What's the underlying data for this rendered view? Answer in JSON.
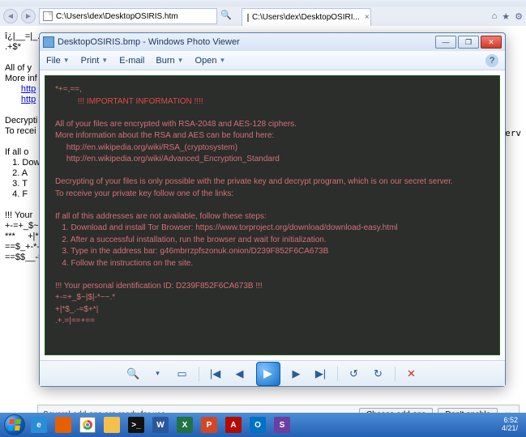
{
  "ie": {
    "address": "C:\\Users\\dex\\DesktopOSIRIS.htm",
    "search_glyph": "🔍",
    "tab_title": "C:\\Users\\dex\\DesktopOSIRI...",
    "winbtns": {
      "home": "⌂",
      "star": "★",
      "gear": "⚙"
    },
    "htm_pre1": "î¿|__=|_.\n.+$*\n\nAll of y\nMore inf",
    "htm_link1": "http",
    "htm_link2": "http",
    "htm_pre2": "\nDecrypti\nTo recei\n\nIf all o\n   1. Dow\n   2. A\n   3. T\n   4. F\n\n!!! Your\n+-=+_$~|\n***     +|*$_.-=\n==$_+-*-\n==$$__-=",
    "htm_right": "serv"
  },
  "pv": {
    "title": "DesktopOSIRIS.bmp - Windows Photo Viewer",
    "menu": {
      "file": "File",
      "print": "Print",
      "email": "E-mail",
      "burn": "Burn",
      "open": "Open"
    },
    "help": "?",
    "winbtns": {
      "min": "—",
      "max": "❐",
      "close": "✕"
    },
    "ctrl": {
      "zoomout": "🔍",
      "zoomdd": "▾",
      "fit": "▭",
      "first": "|◀",
      "prev": "◀",
      "slide": "▶",
      "next": "▶",
      "last": "▶|",
      "rotl": "↺",
      "rotr": "↻",
      "del": "✕"
    },
    "note": {
      "l1": "*+=,==,",
      "l2": "          !!! IMPORTANT INFORMATION !!!!",
      "l3": "All of your files are encrypted with RSA-2048 and AES-128 ciphers.",
      "l4": "More information about the RSA and AES can be found here:",
      "l5": "     http://en.wikipedia.org/wiki/RSA_(cryptosystem)",
      "l6": "     http://en.wikipedia.org/wiki/Advanced_Encryption_Standard",
      "l7": "Decrypting of your files is only possible with the private key and decrypt program, which is on our secret server.",
      "l8": "To receive your private key follow one of the links:",
      "l9": "If all of this addresses are not available, follow these steps:",
      "l10": "   1. Download and install Tor Browser: https://www.torproject.org/download/download-easy.html",
      "l11": "   2. After a successful installation, run the browser and wait for initialization.",
      "l12": "   3. Type in the address bar: g46mbrrzpfszonuk.onion/D239F852F6CA673B",
      "l13": "   4. Follow the instructions on the site.",
      "l14": "!!! Your personal identification ID: D239F852F6CA673B !!!",
      "l15": "+-=+_$~|$|-*~~.*",
      "l16": "+|*$_.-=$+*|",
      "l17": ".+.=|==+=="
    }
  },
  "addon": {
    "msg": "Several add-ons are ready for use.",
    "choose": "Choose add-ons",
    "dont": "Don't enable",
    "close": "×"
  },
  "taskbar": {
    "apps": {
      "ie": "e",
      "ff": "",
      "ch": "",
      "fe": "",
      "cmd": ">_",
      "wd": "W",
      "xl": "X",
      "pp": "P",
      "pdf": "A",
      "ol": "O",
      "sn": "S"
    },
    "time": "6:52",
    "date": "4/21/"
  }
}
